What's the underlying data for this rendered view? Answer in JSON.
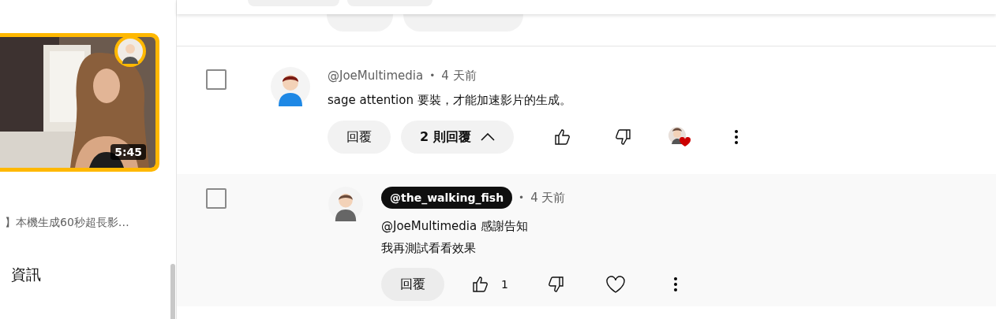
{
  "sidebar": {
    "video": {
      "kind": "picture",
      "duration": "5:45",
      "title": "】本機生成60秒超長影…"
    },
    "section_title": "資訊"
  },
  "comments": [
    {
      "author": "@JoeMultimedia",
      "author_badge": false,
      "separator": "•",
      "time": "4 天前",
      "text": "sage attention 要裝，才能加速影片的生成。",
      "checked": false,
      "reply_button": "回覆",
      "replies_button": "2 則回覆",
      "expanded": true,
      "creator_hearted": true
    }
  ],
  "replies": [
    {
      "author": "@the_walking_fish",
      "author_badge": true,
      "separator": "•",
      "time": "4 天前",
      "lines": [
        "@JoeMultimedia 感謝告知",
        "我再測試看看效果"
      ],
      "checked": false,
      "reply_button": "回覆",
      "likes": "1",
      "creator_hearted": false
    }
  ]
}
